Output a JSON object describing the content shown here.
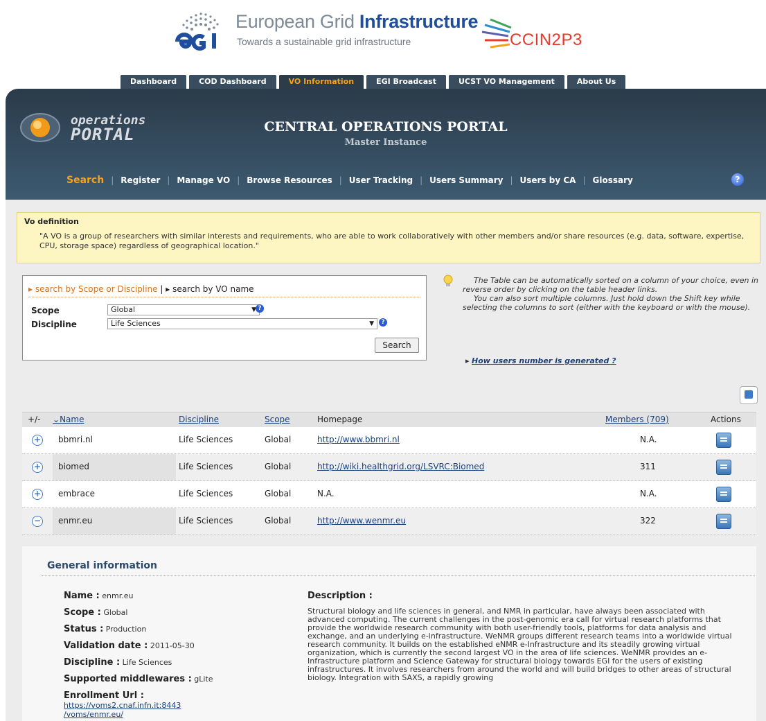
{
  "brand": {
    "egi_title_a": "European Grid ",
    "egi_title_b": "Infrastructure",
    "egi_subtitle": "Towards a sustainable grid infrastructure",
    "cc_name": "CCIN2P3"
  },
  "tabs": [
    "Dashboard",
    "COD Dashboard",
    "VO Information",
    "EGI Broadcast",
    "UCST VO Management",
    "About Us"
  ],
  "header": {
    "logo_line1": "operations",
    "logo_line2": "PORTAL",
    "title": "CENTRAL OPERATIONS PORTAL",
    "subtitle": "Master Instance",
    "help": "?"
  },
  "subnav": [
    "Search",
    "Register",
    "Manage VO",
    "Browse Resources",
    "User Tracking",
    "Users Summary",
    "Users by CA",
    "Glossary"
  ],
  "vo_definition": {
    "heading": "Vo definition",
    "text": "\"A VO is a group of researchers with similar interests and requirements, who are able to work collaboratively with other members and/or share resources (e.g. data, software, expertise, CPU, storage space) regardless of geographical location.\""
  },
  "search": {
    "mode1": "search by Scope or Discipline",
    "sep": " | ",
    "mode2": "search by VO name",
    "scope_label": "Scope",
    "scope_value": "Global",
    "discipline_label": "Discipline",
    "discipline_value": "Life Sciences",
    "button": "Search"
  },
  "tips": {
    "p1": "The Table can be automatically sorted on a column of your choice, even in reverse order by clicking on the table header links.",
    "p2": "You can also sort multiple columns. Just hold down the Shift key while selecting the columns to sort (either with the keyboard or with the mouse).",
    "link": "How users number is generated ?"
  },
  "table": {
    "headers": {
      "toggle": "+/-",
      "name": "Name",
      "discipline": "Discipline",
      "scope": "Scope",
      "homepage": "Homepage",
      "members": "Members (709)",
      "actions": "Actions"
    },
    "rows": [
      {
        "toggle": "+",
        "name": "bbmri.nl",
        "discipline": "Life Sciences",
        "scope": "Global",
        "homepage": "http://www.bbmri.nl",
        "members": "N.A."
      },
      {
        "toggle": "+",
        "name": "biomed",
        "discipline": "Life Sciences",
        "scope": "Global",
        "homepage": "http://wiki.healthgrid.org/LSVRC:Biomed",
        "members": "311"
      },
      {
        "toggle": "+",
        "name": "embrace",
        "discipline": "Life Sciences",
        "scope": "Global",
        "homepage": "N.A.",
        "members": "N.A."
      },
      {
        "toggle": "−",
        "name": "enmr.eu",
        "discipline": "Life Sciences",
        "scope": "Global",
        "homepage": "http://www.wenmr.eu",
        "members": "322"
      }
    ]
  },
  "details": {
    "heading": "General information",
    "name_label": "Name :",
    "name_value": "enmr.eu",
    "scope_label": "Scope :",
    "scope_value": "Global",
    "status_label": "Status :",
    "status_value": "Production",
    "validation_label": "Validation date :",
    "validation_value": "2011-05-30",
    "discipline_label": "Discipline :",
    "discipline_value": "Life Sciences",
    "middleware_label": "Supported middlewares :",
    "middleware_value": "gLite",
    "enrollment_label": "Enrollment Url :",
    "enrollment_value_1": "https://voms2.cnaf.infn.it:8443",
    "enrollment_value_2": "/voms/enmr.eu/",
    "description_label": "Description :",
    "description": "Structural biology and life sciences in general, and NMR in particular, have always been associated with advanced computing. The current challenges in the post-genomic era call for virtual research platforms that provide the worldwide research community with both user-friendly tools, platforms for data analysis and exchange, and an underlying e-infrastructure. WeNMR groups different research teams into a worldwide virtual research community. It builds on the established eNMR e-Infrastructure and its steadily growing virtual organization, which is currently the second largest VO in the area of life sciences. WeNMR provides an e-Infrastructure platform and Science Gateway for structural biology towards EGI for the users of existing infrastructures. It involves researchers from around the world and will build bridges to other areas of structural biology. Integration with SAXS, a rapidly growing"
  }
}
